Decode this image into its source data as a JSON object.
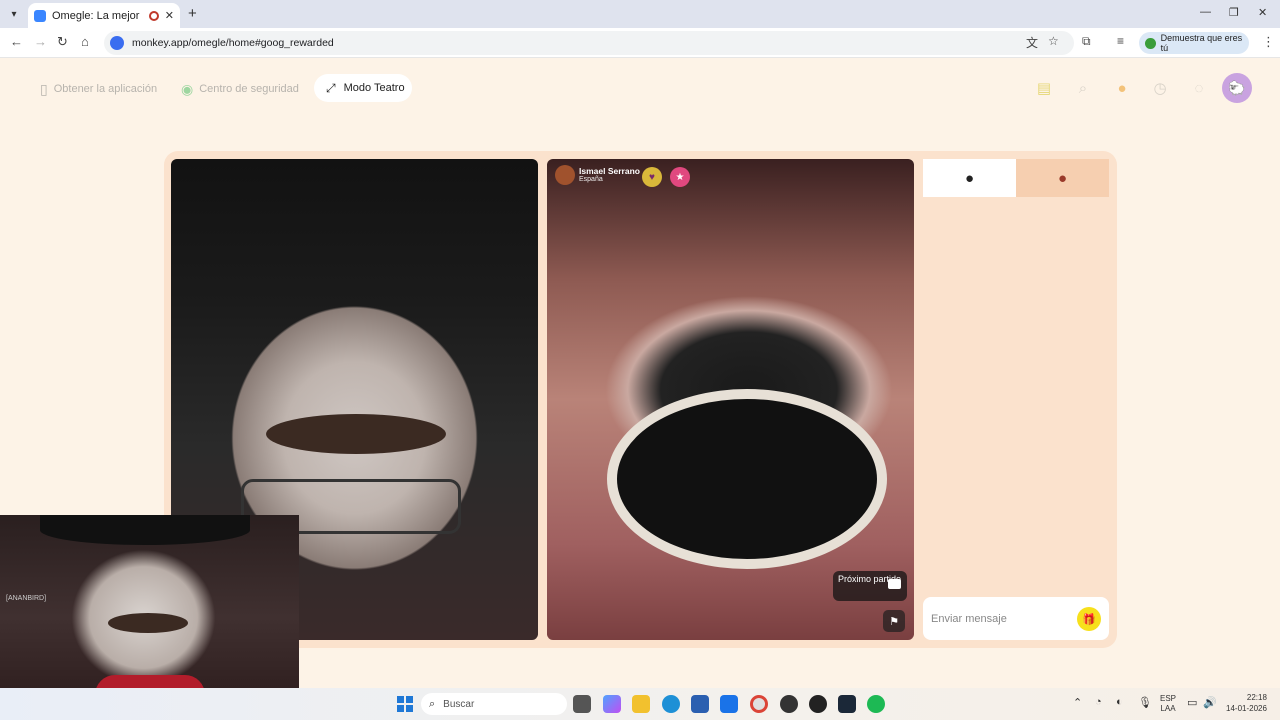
{
  "browser": {
    "tab_title": "Omegle: La mejor alternati",
    "url": "monkey.app/omegle/home#goog_rewarded",
    "verify_chip": "Demuestra que eres tú"
  },
  "header": {
    "get_app": "Obtener la aplicación",
    "safety_center": "Centro de seguridad",
    "theater_mode": "Modo Teatro"
  },
  "partner": {
    "name": "Ismael Serrano",
    "country": "España"
  },
  "next_match": "Próximo partido",
  "chat": {
    "placeholder": "Enviar mensaje"
  },
  "taskbar": {
    "search_placeholder": "Buscar",
    "lang_1": "ESP",
    "lang_2": "LAA",
    "time": "22:18",
    "date": "14-01-2026"
  },
  "webcam_tag": "[ANANBIRD]"
}
